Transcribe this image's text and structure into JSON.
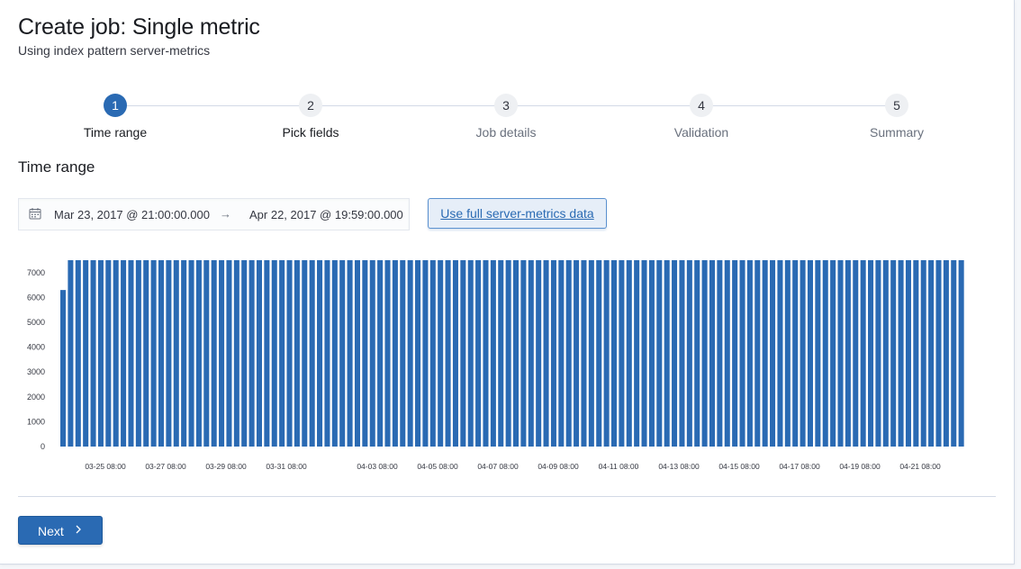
{
  "header": {
    "title": "Create job: Single metric",
    "subtitle": "Using index pattern server-metrics"
  },
  "steps": [
    {
      "number": "1",
      "title": "Time range",
      "state": "active"
    },
    {
      "number": "2",
      "title": "Pick fields",
      "state": "upcoming"
    },
    {
      "number": "3",
      "title": "Job details",
      "state": "upcoming"
    },
    {
      "number": "4",
      "title": "Validation",
      "state": "upcoming"
    },
    {
      "number": "5",
      "title": "Summary",
      "state": "upcoming"
    }
  ],
  "section": {
    "title": "Time range"
  },
  "date_range": {
    "start": "Mar 23, 2017 @ 21:00:00.000",
    "arrow": "→",
    "end": "Apr 22, 2017 @ 19:59:00.000",
    "icon": "calendar-icon"
  },
  "full_data_button": {
    "label": "Use full server-metrics data"
  },
  "chart_data": {
    "type": "bar",
    "color": "#2a6ab3",
    "ylim": [
      0,
      7500
    ],
    "yticks": [
      0,
      1000,
      2000,
      3000,
      4000,
      5000,
      6000,
      7000
    ],
    "first_value": 6300,
    "value": 7500,
    "bar_count": 120,
    "xticks": [
      "03-25 08:00",
      "03-27 08:00",
      "03-29 08:00",
      "03-31 08:00",
      "04-03 08:00",
      "04-05 08:00",
      "04-07 08:00",
      "04-09 08:00",
      "04-11 08:00",
      "04-13 08:00",
      "04-15 08:00",
      "04-17 08:00",
      "04-19 08:00",
      "04-21 08:00"
    ]
  },
  "footer": {
    "next_label": "Next",
    "next_icon": "chevron-right-icon"
  }
}
